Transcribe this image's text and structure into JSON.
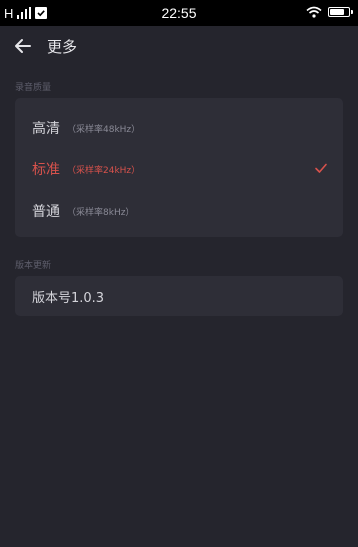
{
  "status_bar": {
    "carrier": "H",
    "time": "22:55",
    "battery_level": 0.85
  },
  "header": {
    "title": "更多"
  },
  "recording_quality": {
    "section_label": "录音质量",
    "options": [
      {
        "name": "高清",
        "sample_rate": "（采样率48kHz）",
        "selected": false
      },
      {
        "name": "标准",
        "sample_rate": "（采样率24kHz）",
        "selected": true
      },
      {
        "name": "普通",
        "sample_rate": "（采样率8kHz）",
        "selected": false
      }
    ]
  },
  "version_update": {
    "section_label": "版本更新",
    "version": "版本号1.0.3"
  },
  "colors": {
    "background": "#25252d",
    "card": "#2e2e37",
    "accent": "#d7524c"
  }
}
